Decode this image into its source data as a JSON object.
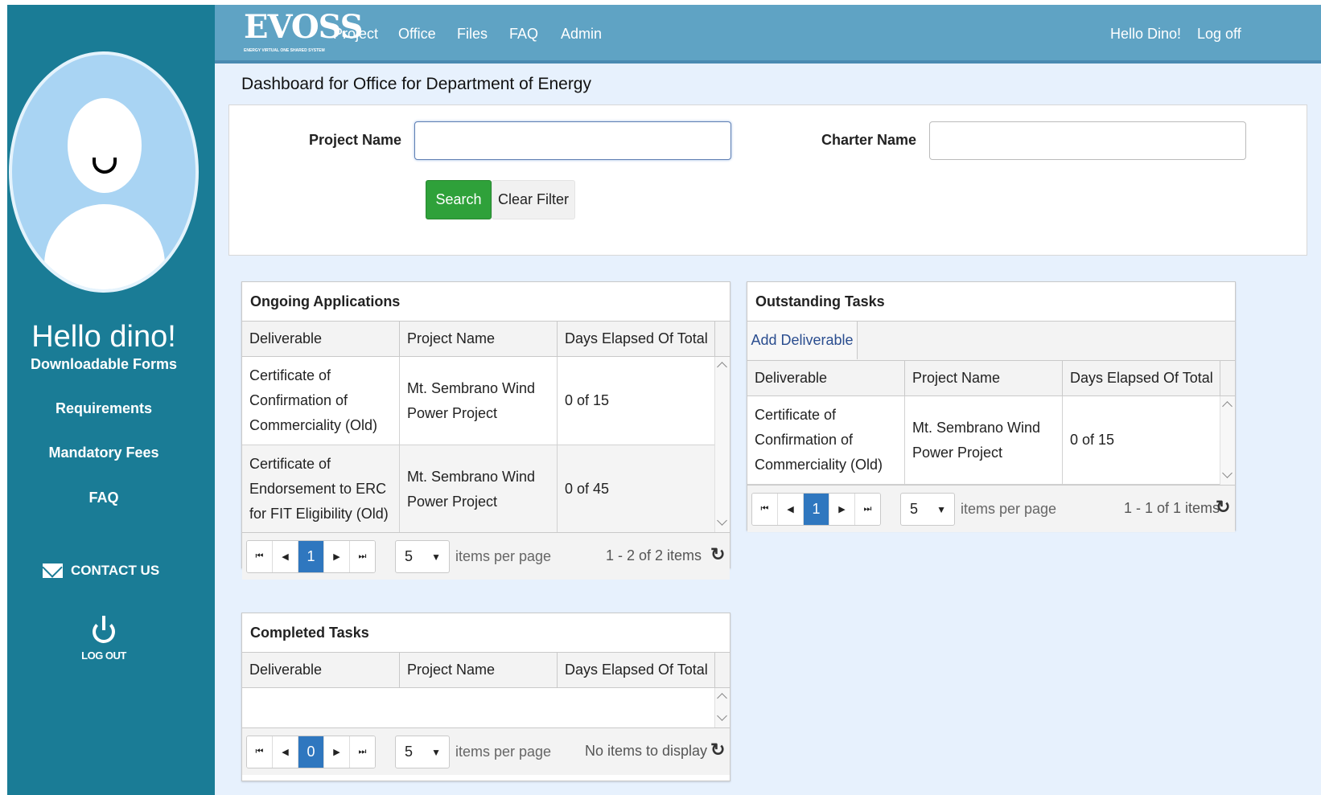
{
  "sidebar": {
    "greeting": "Hello dino!",
    "links": [
      "Downloadable Forms",
      "Requirements",
      "Mandatory Fees",
      "FAQ"
    ],
    "contact": "CONTACT US",
    "logout": "LOG OUT"
  },
  "nav": {
    "logo": "EVOSS",
    "logo_sub": "ENERGY VIRTUAL ONE SHARED SYSTEM",
    "items": [
      "Project",
      "Office",
      "Files",
      "FAQ",
      "Admin"
    ],
    "greeting": "Hello Dino!",
    "logoff": "Log off"
  },
  "page": {
    "title": "Dashboard for Office for Department of Energy"
  },
  "filter": {
    "project_label": "Project Name",
    "project_value": "",
    "charter_label": "Charter Name",
    "charter_value": "",
    "search": "Search",
    "clear": "Clear Filter"
  },
  "ongoing": {
    "title": "Ongoing Applications",
    "columns": [
      "Deliverable",
      "Project Name",
      "Days Elapsed Of Total"
    ],
    "rows": [
      [
        "Certificate of Confirmation of Commerciality (Old)",
        "Mt. Sembrano Wind Power Project",
        "0 of 15"
      ],
      [
        "Certificate of Endorsement to ERC for FIT Eligibility (Old)",
        "Mt. Sembrano Wind Power Project",
        "0 of 45"
      ]
    ],
    "page": "1",
    "page_size": "5",
    "items_label": "items per page",
    "info": "1 - 2 of 2 items"
  },
  "outstanding": {
    "title": "Outstanding Tasks",
    "add": "Add Deliverable",
    "columns": [
      "Deliverable",
      "Project Name",
      "Days Elapsed Of Total"
    ],
    "rows": [
      [
        "Certificate of Confirmation of Commerciality (Old)",
        "Mt. Sembrano Wind Power Project",
        "0 of 15"
      ]
    ],
    "page": "1",
    "page_size": "5",
    "items_label": "items per page",
    "info": "1 - 1 of 1 items"
  },
  "completed": {
    "title": "Completed Tasks",
    "columns": [
      "Deliverable",
      "Project Name",
      "Days Elapsed Of Total"
    ],
    "page": "0",
    "page_size": "5",
    "items_label": "items per page",
    "info": "No items to display"
  },
  "colors": {
    "sidebar": "#1a7c96",
    "nav": "#5fa3c4",
    "accent_green": "#2fa13a",
    "current_page": "#2f77bf"
  }
}
